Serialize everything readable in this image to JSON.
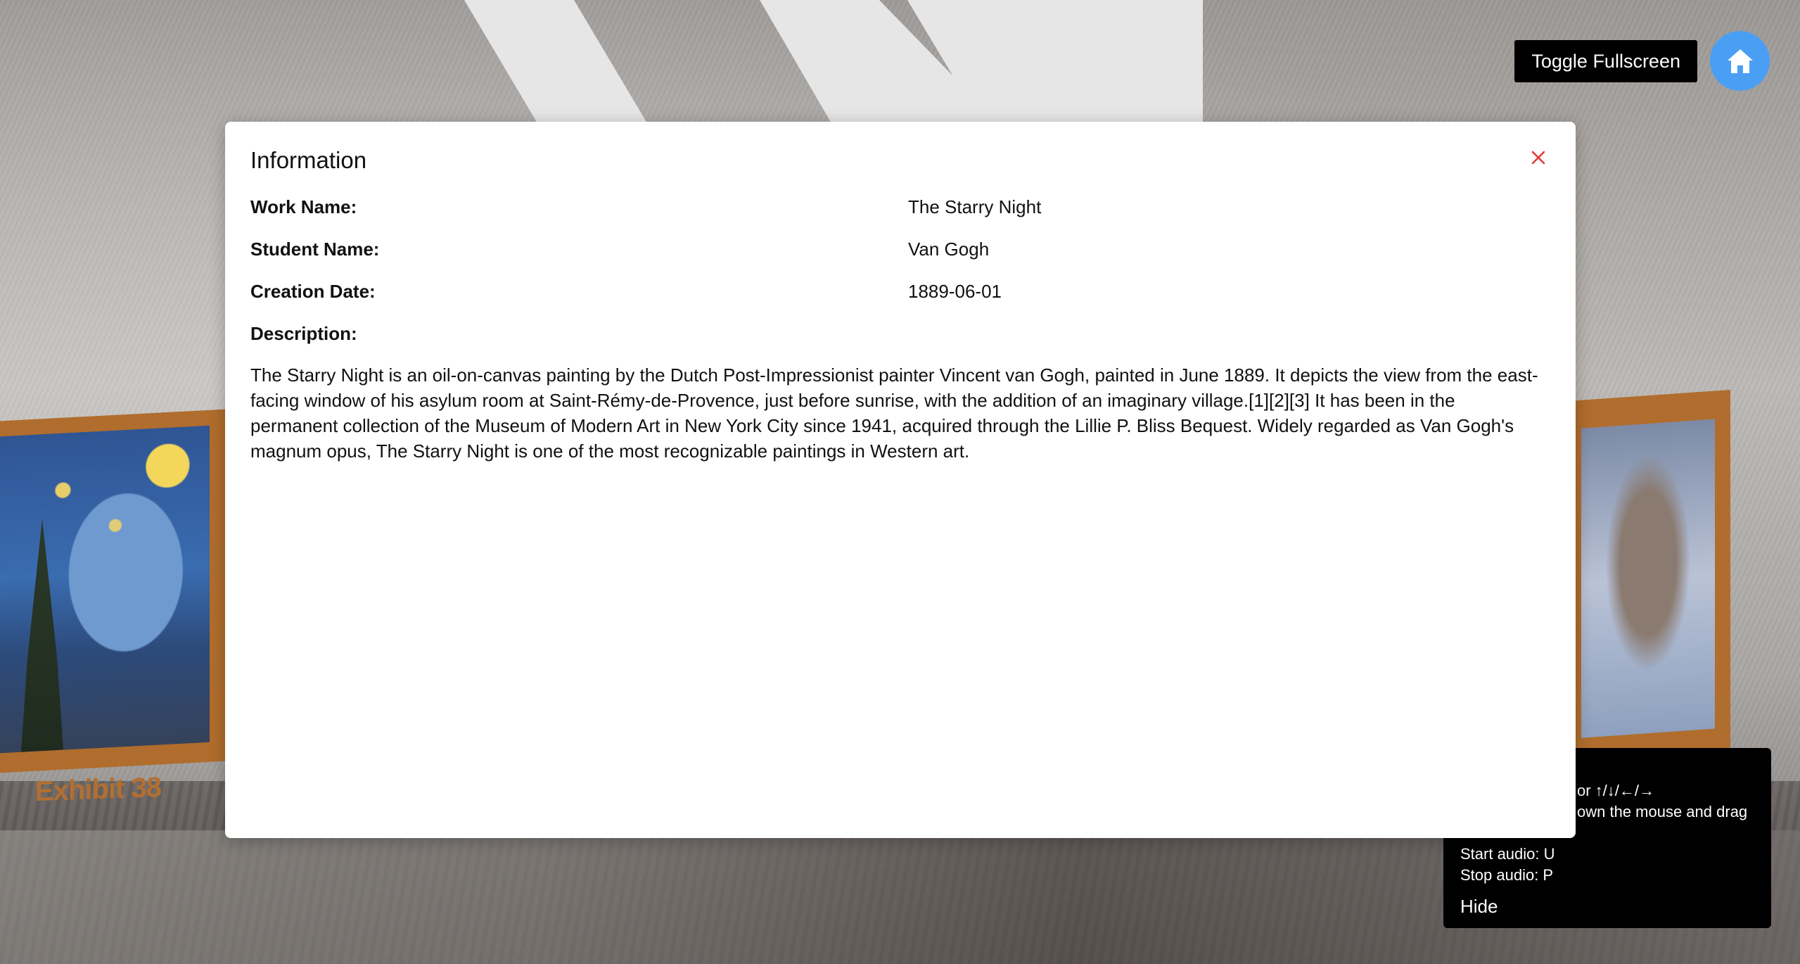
{
  "scene": {
    "exhibit_label": "Exhibit 38"
  },
  "controls": {
    "fullscreen_label": "Toggle Fullscreen",
    "home_icon": "home-icon"
  },
  "modal": {
    "title": "Information",
    "close_icon": "close-icon",
    "fields": [
      {
        "label": "Work Name:",
        "value": "The Starry Night"
      },
      {
        "label": "Student Name:",
        "value": "Van Gogh"
      },
      {
        "label": "Creation Date:",
        "value": "1889-06-01"
      },
      {
        "label": "Description:",
        "value": ""
      }
    ],
    "description": "The Starry Night is an oil-on-canvas painting by the Dutch Post-Impressionist painter Vincent van Gogh, painted in June 1889. It depicts the view from the east-facing window of his asylum room at Saint-Rémy-de-Provence, just before sunrise, with the addition of an imaginary village.[1][2][3] It has been in the permanent collection of the Museum of Modern Art in New York City since 1941, acquired through the Lillie P. Bliss Bequest. Widely regarded as Van Gogh's magnum opus, The Starry Night is one of the most recognizable paintings in Western art."
  },
  "help_panel": {
    "line_1": "or ↑/↓/←/→",
    "line_2": "own the mouse and drag",
    "line_3": "Start audio: U",
    "line_4": "Stop audio: P",
    "hide_label": "Hide"
  },
  "colors": {
    "accent_home": "#4a9ff5",
    "close_red": "#e03a3a",
    "frame": "#b06d2d"
  }
}
